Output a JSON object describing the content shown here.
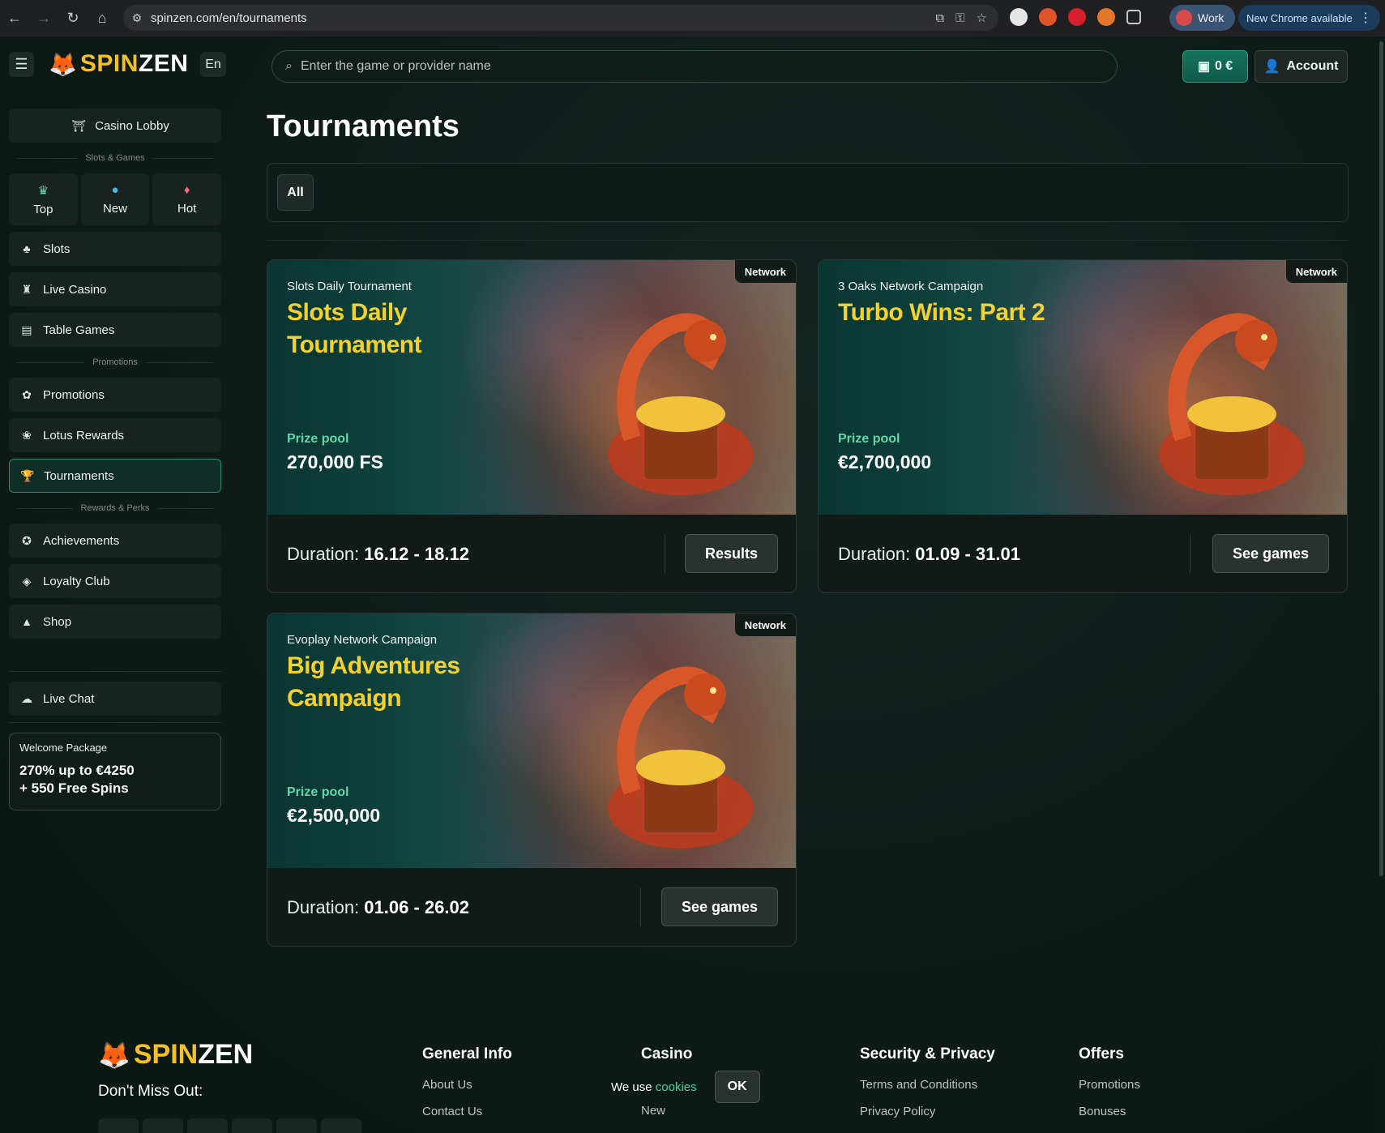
{
  "browser": {
    "url": "spinzen.com/en/tournaments",
    "profile_label": "Work",
    "update_label": "New Chrome available"
  },
  "header": {
    "logo_part1": "SPIN",
    "logo_part2": "ZEN",
    "lang": "En",
    "search_placeholder": "Enter the game or provider name",
    "balance": "0 €",
    "account_label": "Account"
  },
  "sidebar": {
    "lobby": "Casino Lobby",
    "section_slots": "Slots & Games",
    "quick": [
      {
        "label": "Top",
        "icon": "crown-icon"
      },
      {
        "label": "New",
        "icon": "new-icon"
      },
      {
        "label": "Hot",
        "icon": "flame-icon"
      }
    ],
    "items_a": [
      {
        "label": "Slots",
        "icon": "cherries-icon"
      },
      {
        "label": "Live Casino",
        "icon": "dealer-icon"
      },
      {
        "label": "Table Games",
        "icon": "cards-icon"
      }
    ],
    "section_promotions": "Promotions",
    "items_b": [
      {
        "label": "Promotions",
        "icon": "gift-icon"
      },
      {
        "label": "Lotus Rewards",
        "icon": "lotus-icon"
      },
      {
        "label": "Tournaments",
        "icon": "trophy-icon",
        "active": true
      }
    ],
    "section_rewards": "Rewards & Perks",
    "items_c": [
      {
        "label": "Achievements",
        "icon": "medal-icon"
      },
      {
        "label": "Loyalty Club",
        "icon": "diamond-icon"
      },
      {
        "label": "Shop",
        "icon": "bag-icon"
      }
    ],
    "live_chat": "Live Chat",
    "welcome": {
      "title": "Welcome Package",
      "line1": "270% up to €4250",
      "line2": "+ 550 Free Spins"
    }
  },
  "main": {
    "title": "Tournaments",
    "filter_all": "All",
    "cards": [
      {
        "badge": "Network",
        "subtitle": "Slots Daily Tournament",
        "name": "Slots Daily Tournament",
        "prize_label": "Prize pool",
        "prize_value": "270,000 FS",
        "duration_label": "Duration:",
        "duration_value": "16.12 - 18.12",
        "button": "Results"
      },
      {
        "badge": "Network",
        "subtitle": "3 Oaks Network Campaign",
        "name": "Turbo Wins: Part 2",
        "prize_label": "Prize pool",
        "prize_value": "€2,700,000",
        "duration_label": "Duration:",
        "duration_value": "01.09 - 31.01",
        "button": "See games"
      },
      {
        "badge": "Network",
        "subtitle": "Evoplay Network Campaign",
        "name": "Big Adventures Campaign",
        "prize_label": "Prize pool",
        "prize_value": "€2,500,000",
        "duration_label": "Duration:",
        "duration_value": "01.06 - 26.02",
        "button": "See games"
      }
    ]
  },
  "footer": {
    "dont_miss": "Don't Miss Out:",
    "columns": [
      {
        "heading": "General Info",
        "links": [
          "About Us",
          "Contact Us"
        ]
      },
      {
        "heading": "Casino",
        "links": [
          "",
          "New"
        ]
      },
      {
        "heading": "Security & Privacy",
        "links": [
          "Terms and Conditions",
          "Privacy Policy"
        ]
      },
      {
        "heading": "Offers",
        "links": [
          "Promotions",
          "Bonuses"
        ]
      }
    ],
    "cookie_text": "We use",
    "cookie_link": "cookies",
    "cookie_ok": "OK"
  },
  "colors": {
    "accent_yellow": "#f5d12b",
    "accent_green": "#1f8e6a",
    "prize_label": "#5fd9a8"
  }
}
